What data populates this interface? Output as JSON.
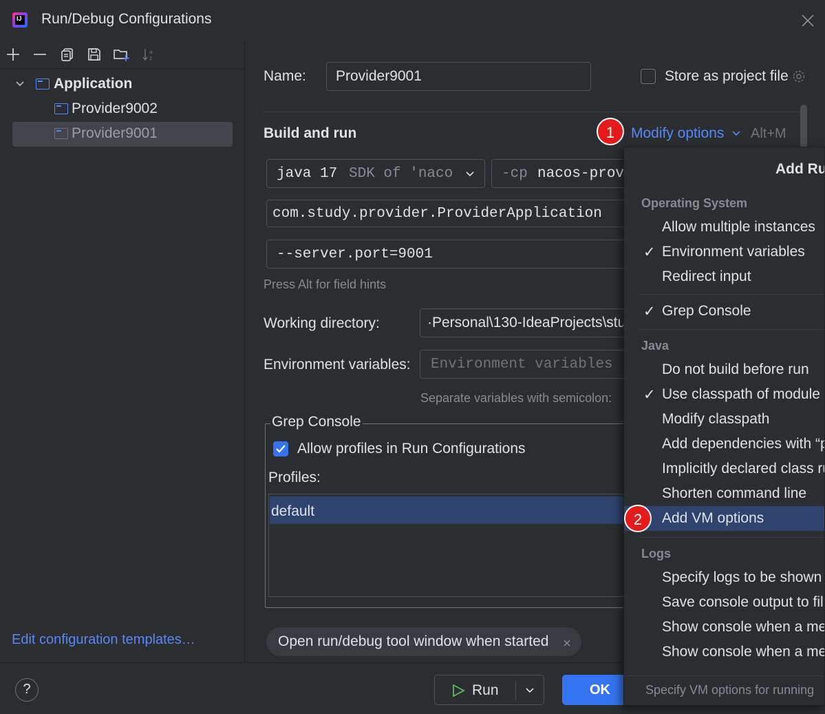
{
  "window": {
    "title": "Run/Debug Configurations",
    "app_icon_letters": "IJ"
  },
  "tree": {
    "group_label": "Application",
    "items": [
      {
        "label": "Provider9002"
      },
      {
        "label": "Provider9001"
      }
    ],
    "edit_templates": "Edit configuration templates…"
  },
  "form": {
    "name_label": "Name:",
    "name_value": "Provider9001",
    "store_label": "Store as project file",
    "section_title": "Build and run",
    "modify_options": "Modify options",
    "modify_shortcut": "Alt+M",
    "jdk_main": "java 17",
    "jdk_detail": "SDK of 'naco",
    "cp_prefix": "-cp",
    "cp_value": "nacos-prov",
    "main_class": "com.study.provider.ProviderApplication",
    "program_args": "--server.port=9001",
    "field_hints": "Press Alt for field hints",
    "working_dir_label": "Working directory:",
    "working_dir_value": "·Personal\\130-IdeaProjects\\stu",
    "env_label": "Environment variables:",
    "env_placeholder": "Environment variables",
    "env_hint": "Separate variables with semicolon:",
    "grep_title": "Grep Console",
    "allow_profiles_label": "Allow profiles in Run Configurations",
    "profiles_label": "Profiles:",
    "profiles": [
      "default"
    ],
    "chip_label": "Open run/debug tool window when started"
  },
  "badges": [
    "1",
    "2"
  ],
  "footer": {
    "help": "?",
    "run_label": "Run",
    "ok_label": "OK"
  },
  "popup": {
    "header": "Add Ru",
    "groups": {
      "os": "Operating System",
      "java": "Java",
      "logs": "Logs"
    },
    "os_items": [
      {
        "label": "Allow multiple instances",
        "checked": false
      },
      {
        "label": "Environment variables",
        "checked": true
      },
      {
        "label": "Redirect input",
        "checked": false
      }
    ],
    "grep_item": {
      "label": "Grep Console",
      "checked": true
    },
    "java_items": [
      {
        "label": "Do not build before run",
        "checked": false
      },
      {
        "label": "Use classpath of module",
        "checked": true
      },
      {
        "label": "Modify classpath",
        "checked": false
      },
      {
        "label": "Add dependencies with “p",
        "checked": false
      },
      {
        "label": "Implicitly declared class ru",
        "checked": false
      },
      {
        "label": "Shorten command line",
        "checked": false
      },
      {
        "label": "Add VM options",
        "checked": false
      }
    ],
    "logs_items": [
      {
        "label": "Specify logs to be shown",
        "checked": false
      },
      {
        "label": "Save console output to fil",
        "checked": false
      },
      {
        "label": "Show console when a mes",
        "checked": false
      },
      {
        "label": "Show console when a mes",
        "checked": false
      }
    ],
    "check_mark": "✓",
    "footer_hint": "Specify VM options for running"
  },
  "colors": {
    "accent": "#3574f0",
    "link": "#548af7",
    "badge": "#e51b1b",
    "selection": "#2e436e"
  }
}
